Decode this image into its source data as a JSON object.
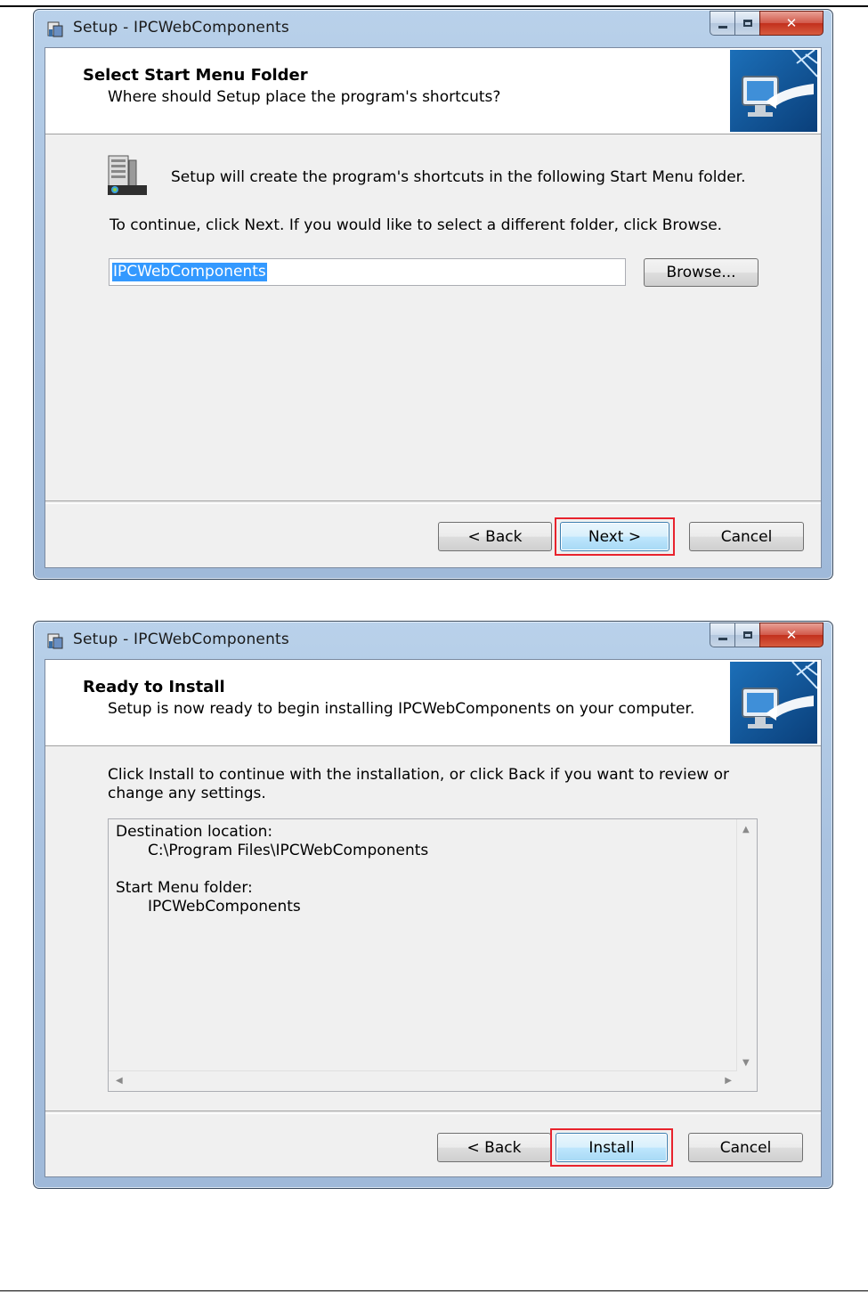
{
  "dialog1": {
    "title": "Setup - IPCWebComponents",
    "header_title": "Select Start Menu Folder",
    "header_subtitle": "Where should Setup place the program's shortcuts?",
    "info_text": "Setup will create the program's shortcuts in the following Start Menu folder.",
    "instruction": "To continue, click Next. If you would like to select a different folder, click Browse.",
    "folder_value": "IPCWebComponents",
    "browse_label": "Browse...",
    "back_label": "< Back",
    "next_label": "Next >",
    "cancel_label": "Cancel"
  },
  "dialog2": {
    "title": "Setup - IPCWebComponents",
    "header_title": "Ready to Install",
    "header_subtitle": "Setup is now ready to begin installing IPCWebComponents on your computer.",
    "instruction_line1": "Click Install to continue with the installation, or click Back if you want to review or",
    "instruction_line2": "change any settings.",
    "summary": {
      "dest_label": "Destination location:",
      "dest_value": "C:\\Program Files\\IPCWebComponents",
      "menu_label": "Start Menu folder:",
      "menu_value": "IPCWebComponents"
    },
    "back_label": "< Back",
    "install_label": "Install",
    "cancel_label": "Cancel"
  },
  "icons": [
    "setup-app-icon",
    "minimize-icon",
    "maximize-icon",
    "close-icon",
    "wizard-computer-icon",
    "start-menu-folder-icon",
    "scroll-up-icon",
    "scroll-down-icon",
    "scroll-left-icon",
    "scroll-right-icon"
  ],
  "colors": {
    "highlight": "#e8232d",
    "selection": "#3399ff",
    "titlebar": "#a9c2e0"
  }
}
